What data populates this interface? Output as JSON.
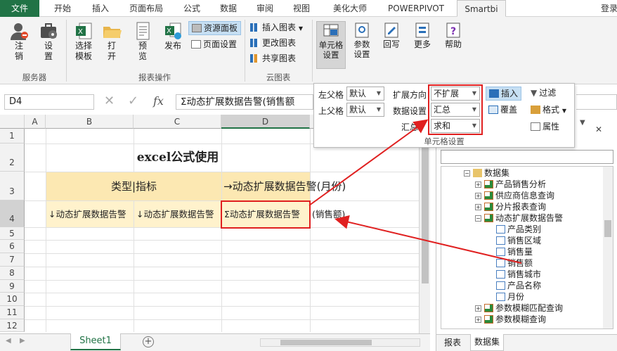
{
  "tabs": [
    "文件",
    "开始",
    "插入",
    "页面布局",
    "公式",
    "数据",
    "审阅",
    "视图",
    "美化大师",
    "POWERPIVOT",
    "Smartbi"
  ],
  "login": "登录",
  "ribbon": {
    "logout": "注销",
    "settings": "设置",
    "choose_template": "选择模板",
    "open": "打开",
    "preview": "预览",
    "publish": "发布",
    "resource_panel": "资源面板",
    "page_setup": "页面设置",
    "insert_chart": "插入图表",
    "change_chart": "更改图表",
    "share_chart": "共享图表",
    "cell_settings": "单元格设置",
    "param_settings": "参数设置",
    "writeback": "回写",
    "more": "更多",
    "help": "帮助",
    "group_server": "服务器",
    "group_report_ops": "报表操作",
    "group_cloud_chart": "云图表"
  },
  "popup": {
    "left_parent_label": "左父格",
    "left_parent_value": "默认",
    "top_parent_label": "上父格",
    "top_parent_value": "默认",
    "expand_dir_label": "扩展方向",
    "expand_dir_value": "不扩展",
    "data_settings_label": "数据设置",
    "data_settings_value": "汇总",
    "summary_label": "汇总",
    "summary_value": "求和",
    "insert": "插入",
    "overwrite": "覆盖",
    "filter": "过滤",
    "format": "格式",
    "properties": "属性",
    "group_title": "单元格设置"
  },
  "formula_bar": {
    "name_box": "D4",
    "fx": "fx",
    "formula": "Σ动态扩展数据告警(销售额"
  },
  "sheet": {
    "columns": [
      "A",
      "B",
      "C",
      "D"
    ],
    "rows": [
      "1",
      "2",
      "3",
      "4",
      "5",
      "6",
      "7",
      "8",
      "9",
      "10",
      "11",
      "12"
    ],
    "title": "excel公式使用",
    "type_indicator": "类型|指标",
    "header_d3": "→动态扩展数据告警(月份)",
    "b4": "↓动态扩展数据告警",
    "c4": "↓动态扩展数据告警",
    "d4": "Σ动态扩展数据告警",
    "d4_overflow": "(销售额)",
    "sheet_tab": "Sheet1"
  },
  "pane": {
    "tree": [
      {
        "label": "数据集",
        "level": 0,
        "expander": "minus",
        "icon": "folder"
      },
      {
        "label": "产品销售分析",
        "level": 1,
        "expander": "plus",
        "icon": "dataset"
      },
      {
        "label": "供应商信息查询",
        "level": 1,
        "expander": "plus",
        "icon": "dataset"
      },
      {
        "label": "分片报表查询",
        "level": 1,
        "expander": "plus",
        "icon": "dataset"
      },
      {
        "label": "动态扩展数据告警",
        "level": 1,
        "expander": "minus",
        "icon": "dataset"
      },
      {
        "label": "产品类别",
        "level": 2,
        "expander": "",
        "icon": "field"
      },
      {
        "label": "销售区域",
        "level": 2,
        "expander": "",
        "icon": "field"
      },
      {
        "label": "销售量",
        "level": 2,
        "expander": "",
        "icon": "field"
      },
      {
        "label": "销售额",
        "level": 2,
        "expander": "",
        "icon": "field"
      },
      {
        "label": "销售城市",
        "level": 2,
        "expander": "",
        "icon": "field"
      },
      {
        "label": "产品名称",
        "level": 2,
        "expander": "",
        "icon": "field"
      },
      {
        "label": "月份",
        "level": 2,
        "expander": "",
        "icon": "field"
      },
      {
        "label": "参数模糊匹配查询",
        "level": 1,
        "expander": "plus",
        "icon": "dataset"
      },
      {
        "label": "参数模糊查询",
        "level": 1,
        "expander": "plus",
        "icon": "dataset"
      }
    ],
    "tab_reports": "报表",
    "tab_datasets": "数据集"
  },
  "colors": {
    "accent": "#217346",
    "highlight": "#fce8b2",
    "highlight_light": "#fff2cc",
    "annotation": "#e02020"
  }
}
